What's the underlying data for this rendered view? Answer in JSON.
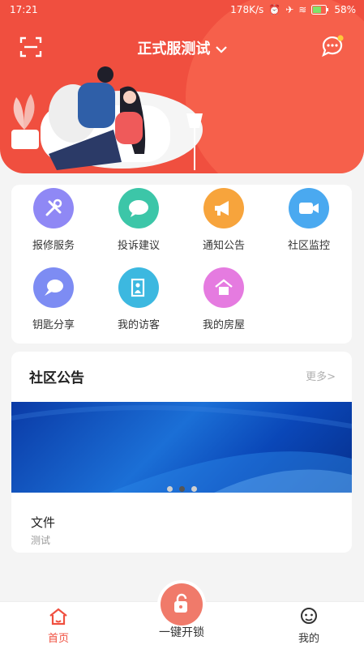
{
  "status": {
    "time": "17:21",
    "speed": "178K/s",
    "battery": "58%"
  },
  "header": {
    "title": "正式服测试",
    "dropdown_icon": "chevron-down-icon",
    "scan_icon": "scan-icon",
    "message_icon": "chat-bubble-icon"
  },
  "services": [
    {
      "label": "报修服务",
      "icon": "wrench-icon",
      "color": "#8f88f5"
    },
    {
      "label": "投诉建议",
      "icon": "chat-bubble-icon",
      "color": "#3cc6a8"
    },
    {
      "label": "通知公告",
      "icon": "megaphone-icon",
      "color": "#f7a43c"
    },
    {
      "label": "社区监控",
      "icon": "camera-icon",
      "color": "#4aa9f0"
    },
    {
      "label": "钥匙分享",
      "icon": "key-share-icon",
      "color": "#7d8cf3"
    },
    {
      "label": "我的访客",
      "icon": "visitor-icon",
      "color": "#3cb8e0"
    },
    {
      "label": "我的房屋",
      "icon": "house-icon",
      "color": "#e57be0"
    }
  ],
  "notice": {
    "title": "社区公告",
    "more": "更多>",
    "item_title": "文件",
    "item_sub": "测试"
  },
  "tabbar": {
    "home": "首页",
    "unlock": "一键开锁",
    "me": "我的"
  },
  "colors": {
    "brand": "#f04f3f",
    "unlock": "#f07a6a"
  }
}
